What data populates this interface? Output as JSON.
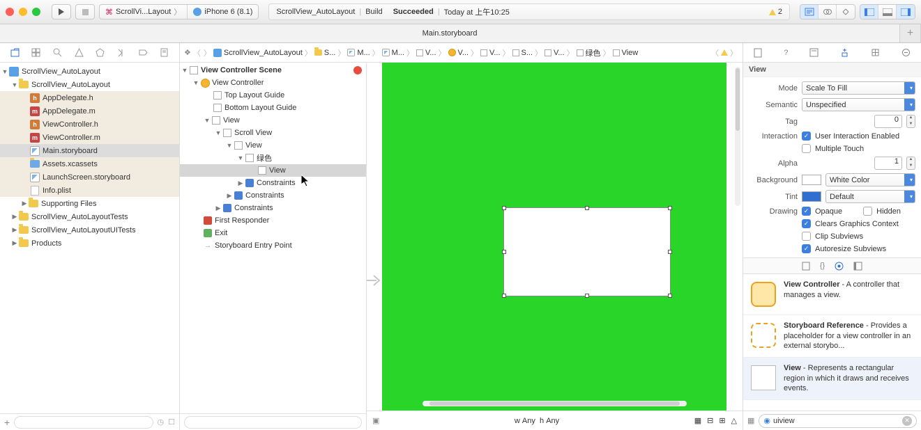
{
  "toolbar": {
    "scheme_project": "ScrollVi...Layout",
    "scheme_device": "iPhone 6 (8.1)",
    "status_project": "ScrollView_AutoLayout",
    "status_build": "Build",
    "status_result": "Succeeded",
    "status_time": "Today at 上午10:25",
    "warn_count": "2"
  },
  "tab": {
    "title": "Main.storyboard"
  },
  "nav": {
    "root": "ScrollView_AutoLayout",
    "grp": "ScrollView_AutoLayout",
    "appdelegate_h": "AppDelegate.h",
    "appdelegate_m": "AppDelegate.m",
    "vc_h": "ViewController.h",
    "vc_m": "ViewController.m",
    "main_sb": "Main.storyboard",
    "assets": "Assets.xcassets",
    "launch": "LaunchScreen.storyboard",
    "info": "Info.plist",
    "supporting": "Supporting Files",
    "tests": "ScrollView_AutoLayoutTests",
    "uitests": "ScrollView_AutoLayoutUITests",
    "products": "Products"
  },
  "jump": {
    "p": "ScrollView_AutoLayout",
    "s1": "S...",
    "m1": "M...",
    "m2": "M...",
    "v1": "V...",
    "v2": "V...",
    "v3": "V...",
    "s2": "S...",
    "v4": "V...",
    "green": "绿色",
    "view": "View"
  },
  "outline": {
    "scene": "View Controller Scene",
    "vc": "View Controller",
    "tlg": "Top Layout Guide",
    "blg": "Bottom Layout Guide",
    "view": "View",
    "scroll": "Scroll View",
    "view2": "View",
    "green": "绿色",
    "view3": "View",
    "constraints": "Constraints",
    "first_responder": "First Responder",
    "exit": "Exit",
    "entry": "Storyboard Entry Point"
  },
  "sizebar": {
    "w": "w",
    "any1": "Any",
    "h": "h",
    "any2": "Any"
  },
  "insp": {
    "hdr": "View",
    "mode_l": "Mode",
    "mode_v": "Scale To Fill",
    "sem_l": "Semantic",
    "sem_v": "Unspecified",
    "tag_l": "Tag",
    "tag_v": "0",
    "inter_l": "Interaction",
    "inter_v": "User Interaction Enabled",
    "multi_v": "Multiple Touch",
    "alpha_l": "Alpha",
    "alpha_v": "1",
    "bg_l": "Background",
    "bg_v": "White Color",
    "tint_l": "Tint",
    "tint_v": "Default",
    "draw_l": "Drawing",
    "opaque_v": "Opaque",
    "hidden_v": "Hidden",
    "clears_v": "Clears Graphics Context",
    "clip_v": "Clip Subviews",
    "auto_v": "Autoresize Subviews"
  },
  "lib": {
    "vc_t": "View Controller",
    "vc_d": " - A controller that manages a view.",
    "sr_t": "Storyboard Reference",
    "sr_d": " - Provides a placeholder for a view controller in an external storybo...",
    "v_t": "View",
    "v_d": " - Represents a rectangular region in which it draws and receives events.",
    "search": "uiview"
  }
}
